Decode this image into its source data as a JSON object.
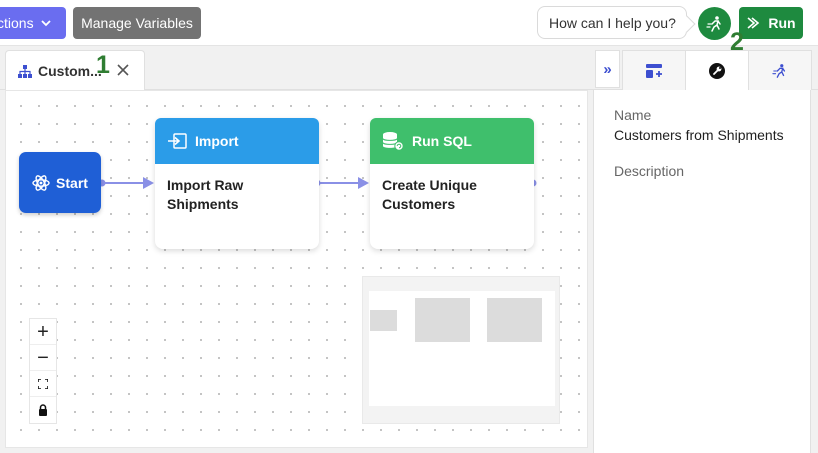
{
  "toolbar": {
    "actions_label": "ctions",
    "manage_variables_label": "Manage Variables",
    "help_prompt": "How can I help you?",
    "run_label": "Run"
  },
  "markers": {
    "one": "1",
    "two": "2"
  },
  "tab": {
    "label": "Custom..."
  },
  "nodes": {
    "start": {
      "label": "Start"
    },
    "import": {
      "header": "Import",
      "line1": "Import Raw",
      "line2": "Shipments"
    },
    "sql": {
      "header": "Run SQL",
      "line1": "Create Unique",
      "line2": "Customers"
    }
  },
  "zoom": {
    "in": "+",
    "out": "−"
  },
  "panel": {
    "collapse": "»",
    "name_label": "Name",
    "name_value": "Customers from Shipments",
    "description_label": "Description"
  },
  "colors": {
    "accent_purple": "#6a6df0",
    "run_green": "#1e8a3f",
    "start_blue": "#1f5fd6",
    "import_blue": "#2b9ce8",
    "sql_green": "#3fbf6c",
    "edge": "#8a90e6"
  },
  "icons": [
    "chevron-down-icon",
    "flow-icon",
    "close-icon",
    "assistant-run-icon",
    "run-arrow-icon",
    "atom-icon",
    "import-arrow-icon",
    "database-icon",
    "fit-view-icon",
    "lock-icon",
    "layout-icon",
    "wrench-icon"
  ]
}
